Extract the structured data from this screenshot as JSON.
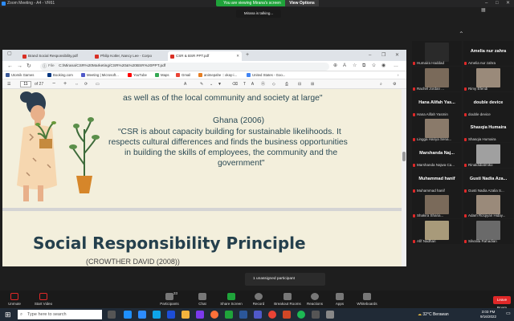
{
  "zoom": {
    "window_title": "Zoom Meeting - A4 - VR61",
    "viewing_banner": "You are viewing Mirana's screen",
    "view_options": "View Options",
    "talking": "Mirana is talking..."
  },
  "browser": {
    "tabs": [
      {
        "label": "Brand Social Responsibility.pdf",
        "active": false
      },
      {
        "label": "Philip Kotler, Nancy Lee - Corpo",
        "active": false
      },
      {
        "label": "CSR & BSR PPT.pdf",
        "active": true
      }
    ],
    "address_label": "File",
    "address": "C:/Mirana/CSR%20Marketing/CSR%20&%20BSR%20PPT.pdf",
    "bookmarks": [
      "Utomik Games",
      "Booking.com",
      "Meeting | Microsoft...",
      "YouTube",
      "Maps",
      "Gmail",
      "animepahe :: okay-i...",
      "United States - Goo..."
    ],
    "pdf": {
      "page_number": "11",
      "page_total": "of 27",
      "page1_lines": [
        "as well as of  the  local community  and society at large\"",
        "Ghana (2006)",
        "“CSR is about capacity building for sustainable likelihoods. It",
        "respects cultural differences and finds the business opportunities",
        "in building the skills of employees, the community and the",
        "government\""
      ],
      "page2_title": "Social Responsibility Principle",
      "page2_author": "(CROWTHER DAVID (2008))"
    }
  },
  "participants": [
    {
      "big": "",
      "name": "Humaira Haddad"
    },
    {
      "big": "Amelia nur zahra",
      "name": "Amelia nur zahra"
    },
    {
      "big": "",
      "name": "Rachel Jordan ..."
    },
    {
      "big": "",
      "name": "Rimy Efendi"
    },
    {
      "big": "Hana Alifah Yas...",
      "name": "Hana Alifah Yasmin"
    },
    {
      "big": "double device",
      "name": "double device"
    },
    {
      "big": "",
      "name": "Lingga Hariya Sena..."
    },
    {
      "big": "Shasqia Humaira",
      "name": "Shasqia Humaira"
    },
    {
      "big": "Marshanda  Naj...",
      "name": "Marshanda Najwa Ca..."
    },
    {
      "big": "",
      "name": "Rinaldidiatmiko"
    },
    {
      "big": "Muhammad hanif",
      "name": "Muhammad hanif"
    },
    {
      "big": "Gusti Nadia Aza...",
      "name": "Gusti Nadia Azalia S..."
    },
    {
      "big": "",
      "name": "Shakira Sharia..."
    },
    {
      "big": "",
      "name": "Adam Rizqiyan Hiday..."
    },
    {
      "big": "",
      "name": "Afif Nadhari"
    },
    {
      "big": "",
      "name": "Silvalila Rahadian"
    }
  ],
  "toolbar": {
    "unmute": "Unmute",
    "start_video": "Start Video",
    "participants": "Participants",
    "participants_count": "33",
    "chat": "Chat",
    "share_screen": "Share Screen",
    "record": "Record",
    "breakout": "Breakout Rooms",
    "reactions": "Reactions",
    "apps": "Apps",
    "whiteboards": "Whiteboards",
    "leave": "Leave Room",
    "popup": "1 unassigned participant"
  },
  "taskbar": {
    "search": "Type here to search",
    "weather": "32°C  Berawan",
    "time": "3:03 PM",
    "date": "9/16/2022"
  }
}
